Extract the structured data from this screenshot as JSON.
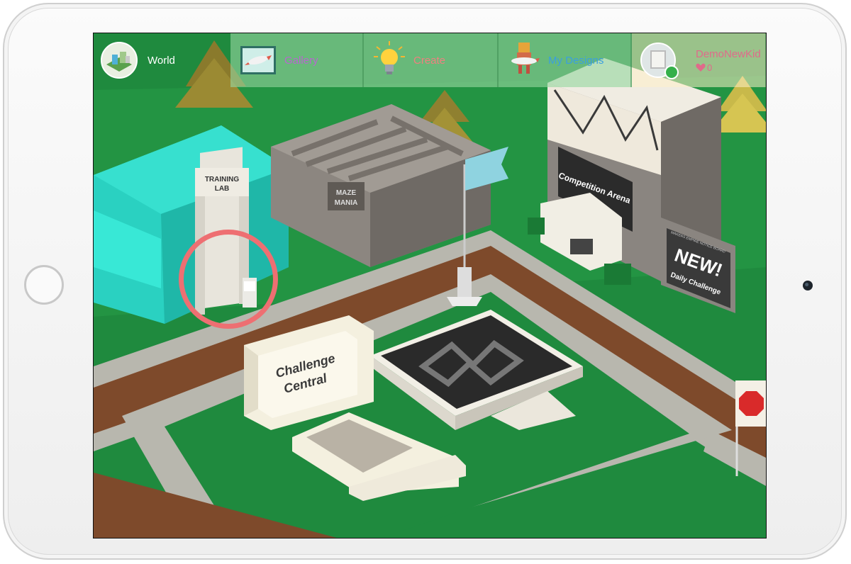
{
  "topbar": {
    "world": {
      "label": "World",
      "icon": "globe-city-icon"
    },
    "tabs": [
      {
        "label": "Gallery",
        "icon": "rocket-picture-icon",
        "color": "#b867cf"
      },
      {
        "label": "Create",
        "icon": "lightbulb-icon",
        "color": "#f07f7f"
      },
      {
        "label": "My Designs",
        "icon": "robot-rocket-icon",
        "color": "#3a9fe0"
      }
    ],
    "user": {
      "name": "DemoNewKid",
      "likes": "0",
      "icon": "heart-icon",
      "status_icon": "wifi-icon"
    }
  },
  "scene": {
    "training_lab": {
      "line1": "TRAINING",
      "line2": "LAB"
    },
    "maze_mania": {
      "line1": "MAZE",
      "line2": "MANIA"
    },
    "competition_arena": "Competition Arena",
    "notice_board": {
      "header": "MAKERS EMPIRE NOTICE BOARD",
      "title": "NEW!",
      "subtitle": "Daily Challenge"
    },
    "challenge_central": {
      "line1": "Challenge",
      "line2": "Central"
    },
    "colors": {
      "grass": "#1f8a3e",
      "path_stone": "#b8b7ae",
      "path_dirt": "#7e4a2b",
      "highlight_ring": "#ee6f72",
      "teal_building": "#2fd3c4"
    }
  }
}
